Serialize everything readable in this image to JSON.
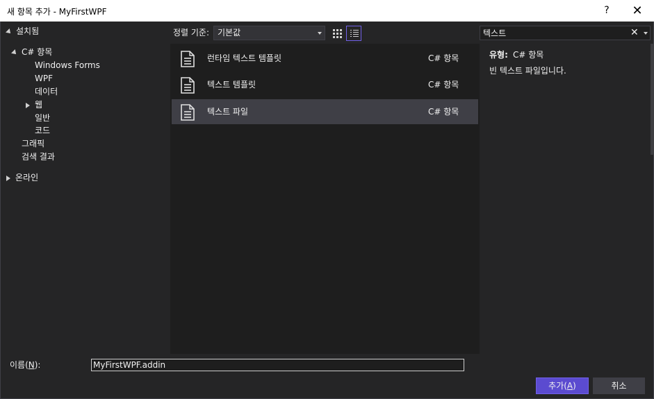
{
  "window": {
    "title": "새 항목 추가 - MyFirstWPF",
    "help_label": "?",
    "close_label": "✕"
  },
  "tree": {
    "installed": "설치됨",
    "csharp": "C# 항목",
    "children": [
      "Windows Forms",
      "WPF",
      "데이터",
      "웹",
      "일반",
      "코드"
    ],
    "graphics": "그래픽",
    "search_results": "검색 결과",
    "online": "온라인"
  },
  "toolbar": {
    "sort_label": "정렬 기준:",
    "sort_value": "기본값",
    "view_grid_icon": "grid-view-icon",
    "view_list_icon": "list-view-icon"
  },
  "search": {
    "value": "텍스트",
    "clear_label": "✕"
  },
  "templates": [
    {
      "name": "런타임 텍스트 템플릿",
      "lang": "C# 항목",
      "icon": "text-document-icon",
      "selected": false
    },
    {
      "name": "텍스트 템플릿",
      "lang": "C# 항목",
      "icon": "text-document-icon",
      "selected": false
    },
    {
      "name": "텍스트 파일",
      "lang": "C# 항목",
      "icon": "text-document-icon",
      "selected": true
    }
  ],
  "details": {
    "type_label": "유형:",
    "type_value": "C# 항목",
    "description": "빈 텍스트 파일입니다."
  },
  "name_field": {
    "label_prefix": "이름(",
    "label_key": "N",
    "label_suffix": "):",
    "value": "MyFirstWPF.addin"
  },
  "buttons": {
    "add_prefix": "추가(",
    "add_key": "A",
    "add_suffix": ")",
    "cancel": "취소"
  },
  "colors": {
    "accent": "#5b4bd0",
    "background": "#252526",
    "list_background": "#1e1e1e",
    "selection": "#3f3f46"
  }
}
